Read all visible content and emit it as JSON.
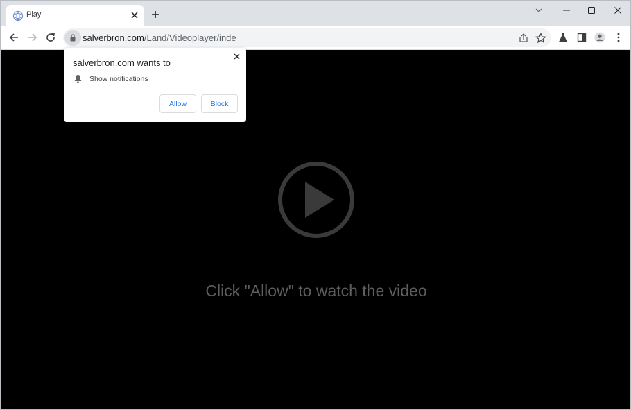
{
  "tab": {
    "title": "Play",
    "favicon": "globe-favicon-icon"
  },
  "window_controls": [
    "chevron-down-icon",
    "minimize-icon",
    "maximize-icon",
    "close-icon"
  ],
  "toolbar": {
    "back": "arrow-left-icon",
    "forward": "arrow-right-icon",
    "reload": "reload-icon",
    "url_host": "salverbron.com",
    "url_path": "/Land/Videoplayer/index.html",
    "omnibox_icons": [
      "share-icon",
      "star-icon"
    ],
    "right_icons": [
      "labs-icon",
      "side-panel-icon",
      "profile-icon",
      "kebab-menu-icon"
    ]
  },
  "permission_popup": {
    "title": "salverbron.com wants to",
    "item": "Show notifications",
    "allow_label": "Allow",
    "block_label": "Block"
  },
  "page": {
    "cta_text": "Click \"Allow\" to watch the video",
    "play_icon": "play-circle-icon"
  },
  "colors": {
    "accent": "#1a73e8",
    "page_bg": "#000000",
    "tabstrip_bg": "#dee1e6",
    "cta_text": "#5d5d5d",
    "play_icon": "#3a3a3a"
  }
}
